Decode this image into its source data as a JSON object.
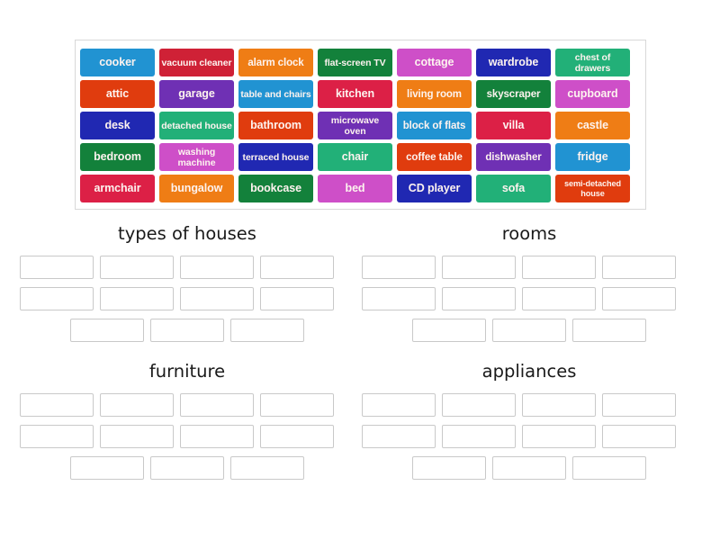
{
  "activity": {
    "type": "group-sort",
    "word_bank": {
      "columns": 7,
      "rows": 5,
      "tiles": [
        [
          {
            "label": "cooker",
            "color": "#2193d2",
            "size": "normal"
          },
          {
            "label": "vacuum cleaner",
            "color": "#cf2136",
            "size": "small"
          },
          {
            "label": "alarm clock",
            "color": "#ef7d15",
            "size": "med"
          },
          {
            "label": "flat-screen TV",
            "color": "#13813b",
            "size": "small"
          },
          {
            "label": "cottage",
            "color": "#ce4fc8",
            "size": "normal"
          },
          {
            "label": "wardrobe",
            "color": "#2028b2",
            "size": "normal"
          },
          {
            "label": "chest of drawers",
            "color": "#22b078",
            "size": "small"
          }
        ],
        [
          {
            "label": "attic",
            "color": "#e03c0e",
            "size": "normal"
          },
          {
            "label": "garage",
            "color": "#6f30b4",
            "size": "normal"
          },
          {
            "label": "table and chairs",
            "color": "#2193d2",
            "size": "small"
          },
          {
            "label": "kitchen",
            "color": "#dc2046",
            "size": "normal"
          },
          {
            "label": "living room",
            "color": "#ef7d15",
            "size": "med"
          },
          {
            "label": "skyscraper",
            "color": "#13813b",
            "size": "med"
          },
          {
            "label": "cupboard",
            "color": "#ce4fc8",
            "size": "normal"
          }
        ],
        [
          {
            "label": "desk",
            "color": "#2028b2",
            "size": "normal"
          },
          {
            "label": "detached house",
            "color": "#22b078",
            "size": "small"
          },
          {
            "label": "bathroom",
            "color": "#e03c0e",
            "size": "normal"
          },
          {
            "label": "microwave oven",
            "color": "#6f30b4",
            "size": "small"
          },
          {
            "label": "block of flats",
            "color": "#2193d2",
            "size": "med"
          },
          {
            "label": "villa",
            "color": "#dc2046",
            "size": "normal"
          },
          {
            "label": "castle",
            "color": "#ef7d15",
            "size": "normal"
          }
        ],
        [
          {
            "label": "bedroom",
            "color": "#13813b",
            "size": "normal"
          },
          {
            "label": "washing machine",
            "color": "#ce4fc8",
            "size": "small"
          },
          {
            "label": "terraced house",
            "color": "#2028b2",
            "size": "small"
          },
          {
            "label": "chair",
            "color": "#22b078",
            "size": "normal"
          },
          {
            "label": "coffee table",
            "color": "#e03c0e",
            "size": "med"
          },
          {
            "label": "dishwasher",
            "color": "#6f30b4",
            "size": "med"
          },
          {
            "label": "fridge",
            "color": "#2193d2",
            "size": "normal"
          }
        ],
        [
          {
            "label": "armchair",
            "color": "#dc2046",
            "size": "normal"
          },
          {
            "label": "bungalow",
            "color": "#ef7d15",
            "size": "normal"
          },
          {
            "label": "bookcase",
            "color": "#13813b",
            "size": "normal"
          },
          {
            "label": "bed",
            "color": "#ce4fc8",
            "size": "normal"
          },
          {
            "label": "CD player",
            "color": "#2028b2",
            "size": "normal"
          },
          {
            "label": "sofa",
            "color": "#22b078",
            "size": "normal"
          },
          {
            "label": "semi-detached house",
            "color": "#e03c0e",
            "size": "tiny"
          }
        ]
      ]
    },
    "categories": [
      {
        "title": "types of houses",
        "slot_rows": [
          4,
          4,
          3
        ]
      },
      {
        "title": "rooms",
        "slot_rows": [
          4,
          4,
          3
        ]
      },
      {
        "title": "furniture",
        "slot_rows": [
          4,
          4,
          3
        ]
      },
      {
        "title": "appliances",
        "slot_rows": [
          4,
          4,
          3
        ]
      }
    ]
  }
}
